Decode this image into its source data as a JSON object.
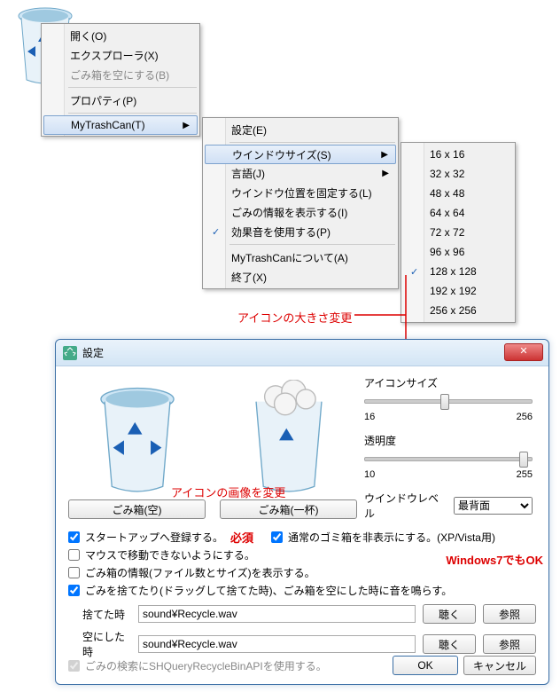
{
  "context1": {
    "items": [
      {
        "label": "開く(O)"
      },
      {
        "label": "エクスプローラ(X)"
      },
      {
        "label": "ごみ箱を空にする(B)",
        "disabled": true
      },
      {
        "sep": true
      },
      {
        "label": "プロパティ(P)"
      },
      {
        "sep": true
      },
      {
        "label": "MyTrashCan(T)",
        "arrow": true,
        "hl": true
      }
    ]
  },
  "context2": {
    "items": [
      {
        "label": "設定(E)"
      },
      {
        "sep": true
      },
      {
        "label": "ウインドウサイズ(S)",
        "arrow": true,
        "hl": true
      },
      {
        "label": "言語(J)",
        "arrow": true
      },
      {
        "label": "ウインドウ位置を固定する(L)"
      },
      {
        "label": "ごみの情報を表示する(I)"
      },
      {
        "label": "効果音を使用する(P)",
        "check": true
      },
      {
        "sep": true
      },
      {
        "label": "MyTrashCanについて(A)"
      },
      {
        "label": "終了(X)"
      }
    ]
  },
  "context3": {
    "items": [
      {
        "label": "16 x 16"
      },
      {
        "label": "32 x 32"
      },
      {
        "label": "48 x 48"
      },
      {
        "label": "64 x 64"
      },
      {
        "label": "72 x 72"
      },
      {
        "label": "96 x 96"
      },
      {
        "label": "128 x 128",
        "check": true
      },
      {
        "label": "192 x 192"
      },
      {
        "label": "256 x 256"
      }
    ]
  },
  "annotations": {
    "icon_size": "アイコンの大きさ変更",
    "icon_image": "アイコンの画像を変更",
    "required": "必須",
    "win7": "Windows7でもOK"
  },
  "dialog": {
    "title": "設定",
    "preview": {
      "empty_btn": "ごみ箱(空)",
      "full_btn": "ごみ箱(一杯)"
    },
    "sliders": {
      "icon_label": "アイコンサイズ",
      "icon_min": "16",
      "icon_max": "256",
      "opacity_label": "透明度",
      "opacity_min": "10",
      "opacity_max": "255"
    },
    "window_level": {
      "label": "ウインドウレベル",
      "value": "最背面"
    },
    "checks": {
      "startup": "スタートアップへ登録する。",
      "normal_hide": "通常のゴミ箱を非表示にする。(XP/Vista用)",
      "no_mouse_move": "マウスで移動できないようにする。",
      "show_info": "ごみ箱の情報(ファイル数とサイズ)を表示する。",
      "play_sound": "ごみを捨てたり(ドラッグして捨てた時)、ごみ箱を空にした時に音を鳴らす。"
    },
    "sounds": {
      "drop_label": "捨てた時",
      "drop_value": "sound¥Recycle.wav",
      "empty_label": "空にした時",
      "empty_value": "sound¥Recycle.wav",
      "listen_btn": "聴く",
      "browse_btn": "参照"
    },
    "footer": {
      "api": "ごみの検索にSHQueryRecycleBinAPIを使用する。",
      "ok": "OK",
      "cancel": "キャンセル"
    }
  }
}
